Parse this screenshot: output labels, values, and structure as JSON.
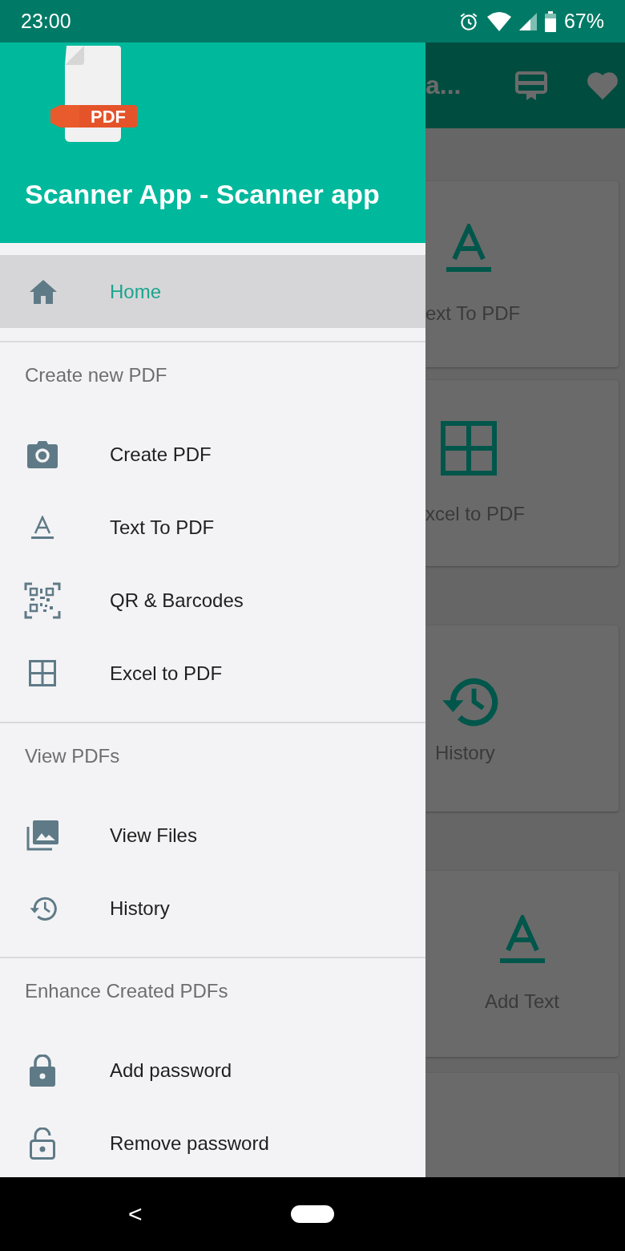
{
  "status_bar": {
    "time": "23:00",
    "battery": "67%"
  },
  "background_app": {
    "toolbar_title": "a...",
    "cards": [
      {
        "label": "ext To PDF"
      },
      {
        "label": "xcel to PDF"
      },
      {
        "label": "History"
      },
      {
        "label": "Add Text"
      }
    ]
  },
  "drawer": {
    "title": "Scanner App - Scanner app",
    "logo_text": "PDF",
    "home": {
      "label": "Home",
      "selected": true
    },
    "sections": [
      {
        "title": "Create new PDF",
        "items": [
          {
            "label": "Create PDF",
            "selected": false
          },
          {
            "label": "Text To PDF",
            "selected": false
          },
          {
            "label": "QR & Barcodes",
            "selected": false
          },
          {
            "label": "Excel to PDF",
            "selected": false
          }
        ]
      },
      {
        "title": "View PDFs",
        "items": [
          {
            "label": "View Files",
            "selected": false
          },
          {
            "label": "History",
            "selected": false
          }
        ]
      },
      {
        "title": "Enhance Created PDFs",
        "items": [
          {
            "label": "Add password",
            "selected": false
          },
          {
            "label": "Remove password",
            "selected": false
          }
        ]
      }
    ]
  },
  "nav_bar": {
    "back": "<"
  }
}
